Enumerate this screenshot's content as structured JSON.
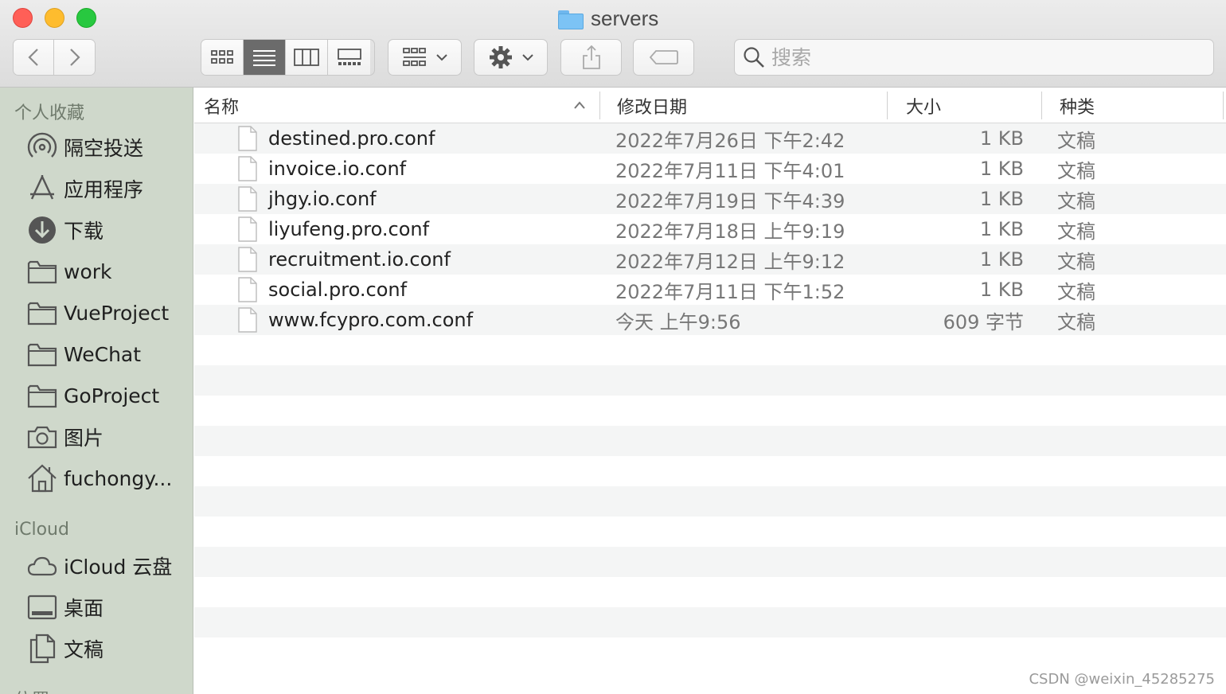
{
  "window": {
    "title": "servers"
  },
  "search": {
    "placeholder": "搜索"
  },
  "sidebar": {
    "sections": [
      {
        "heading": "个人收藏"
      },
      {
        "heading": "iCloud"
      },
      {
        "heading": "位置"
      }
    ],
    "favorites": [
      {
        "label": "隔空投送",
        "icon": "airdrop-icon"
      },
      {
        "label": "应用程序",
        "icon": "applications-icon"
      },
      {
        "label": "下载",
        "icon": "downloads-icon"
      },
      {
        "label": "work",
        "icon": "folder-icon"
      },
      {
        "label": "VueProject",
        "icon": "folder-icon"
      },
      {
        "label": "WeChat",
        "icon": "folder-icon"
      },
      {
        "label": "GoProject",
        "icon": "folder-icon"
      },
      {
        "label": "图片",
        "icon": "camera-icon"
      },
      {
        "label": "fuchongy...",
        "icon": "home-icon"
      }
    ],
    "icloud": [
      {
        "label": "iCloud 云盘",
        "icon": "cloud-icon"
      },
      {
        "label": "桌面",
        "icon": "desktop-icon"
      },
      {
        "label": "文稿",
        "icon": "documents-icon"
      }
    ]
  },
  "columns": {
    "name": "名称",
    "date": "修改日期",
    "size": "大小",
    "kind": "种类"
  },
  "files": [
    {
      "name": "destined.pro.conf",
      "date": "2022年7月26日 下午2:42",
      "size": "1 KB",
      "kind": "文稿"
    },
    {
      "name": "invoice.io.conf",
      "date": "2022年7月11日 下午4:01",
      "size": "1 KB",
      "kind": "文稿"
    },
    {
      "name": "jhgy.io.conf",
      "date": "2022年7月19日 下午4:39",
      "size": "1 KB",
      "kind": "文稿"
    },
    {
      "name": "liyufeng.pro.conf",
      "date": "2022年7月18日 上午9:19",
      "size": "1 KB",
      "kind": "文稿"
    },
    {
      "name": "recruitment.io.conf",
      "date": "2022年7月12日 上午9:12",
      "size": "1 KB",
      "kind": "文稿"
    },
    {
      "name": "social.pro.conf",
      "date": "2022年7月11日 下午1:52",
      "size": "1 KB",
      "kind": "文稿"
    },
    {
      "name": "www.fcypro.com.conf",
      "date": "今天 上午9:56",
      "size": "609 字节",
      "kind": "文稿"
    }
  ],
  "watermark": "CSDN @weixin_45285275",
  "colors": {
    "sidebar_bg": "#cfd8cb",
    "toolbar_bg": "#e3e3e3",
    "active_view_button": "#6b6b6b",
    "folder_blue": "#7cc3f5",
    "row_stripe": "#f4f5f5"
  }
}
